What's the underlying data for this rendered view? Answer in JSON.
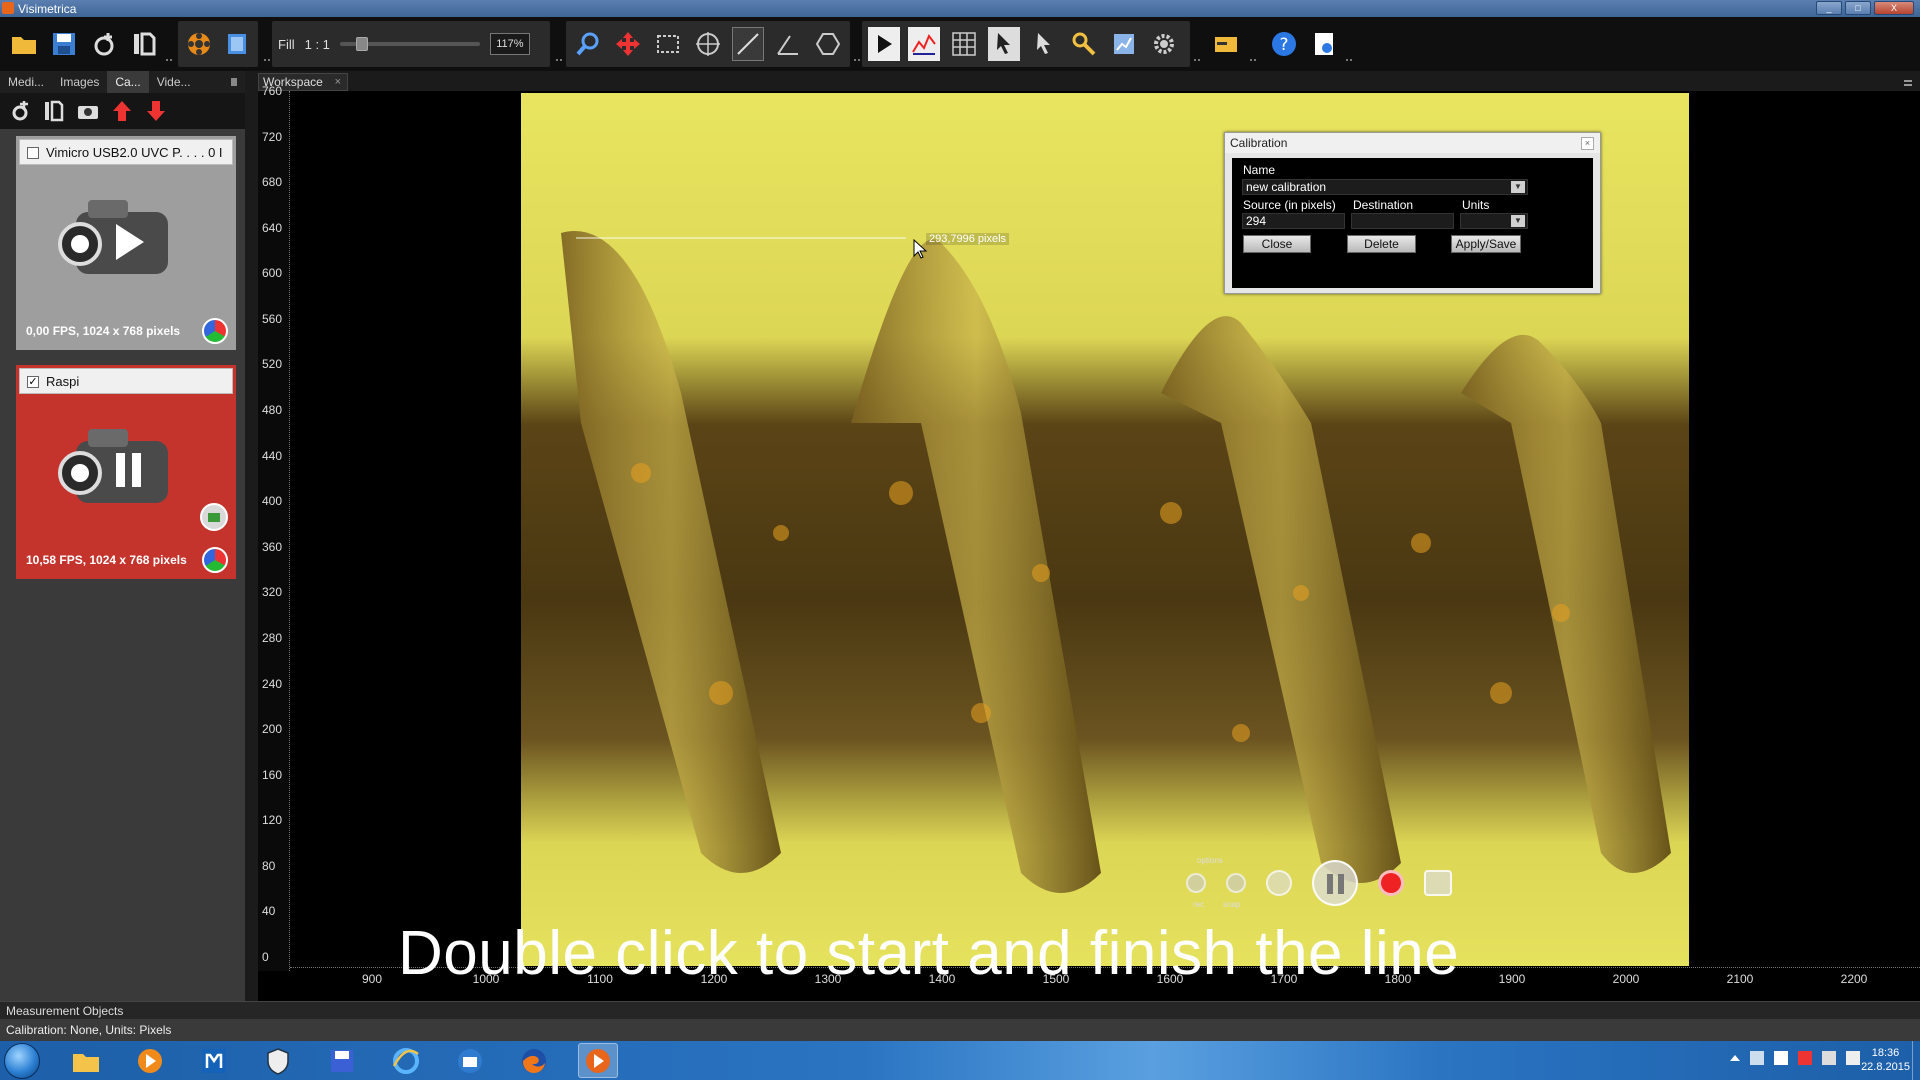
{
  "window": {
    "title": "Visimetrica"
  },
  "toolbar": {
    "fill_label": "Fill",
    "ratio_label": "1 : 1",
    "zoom_value": "117%"
  },
  "left_panel": {
    "tabs": [
      "Medi...",
      "Images",
      "Ca...",
      "Vide..."
    ],
    "cameras": [
      {
        "name": "Vimicro USB2.0 UVC P. . . . 0 I",
        "checked": "",
        "status": "0,00 FPS, 1024 x 768 pixels"
      },
      {
        "name": "Raspi",
        "checked": "✓",
        "status": "10,58 FPS, 1024 x 768 pixels"
      }
    ]
  },
  "workspace": {
    "tab_label": "Workspace",
    "tab_close": "×",
    "y_ticks": [
      "760",
      "720",
      "680",
      "640",
      "600",
      "560",
      "520",
      "480",
      "440",
      "400",
      "360",
      "320",
      "280",
      "240",
      "200",
      "160",
      "120",
      "80",
      "40",
      "0"
    ],
    "x_ticks": [
      "900",
      "1000",
      "1100",
      "1200",
      "1300",
      "1400",
      "1500",
      "1600",
      "1700",
      "1800",
      "1900",
      "2000",
      "2100",
      "2200"
    ],
    "measure_label": "293,7996 pixels",
    "overlay_caption": "Double click to start and finish the line",
    "player": {
      "options_label": "options",
      "rec_label": "rec",
      "snap_label": "snap"
    }
  },
  "calibration": {
    "title": "Calibration",
    "close_x": "×",
    "name_label": "Name",
    "name_value": "new calibration",
    "source_label": "Source (in pixels)",
    "source_value": "294",
    "destination_label": "Destination",
    "destination_value": "",
    "units_label": "Units",
    "units_value": "",
    "close_button": "Close",
    "delete_button": "Delete",
    "apply_button": "Apply/Save"
  },
  "bottom": {
    "measurement_tab": "Measurement Objects",
    "status": "Calibration: None, Units: Pixels"
  },
  "taskbar": {
    "time": "18:36",
    "date": "22.8.2015"
  },
  "colors": {
    "accent_red": "#c4342d",
    "titlebar_blue": "#3f6597",
    "specimen_yellow": "#e5e25e"
  }
}
